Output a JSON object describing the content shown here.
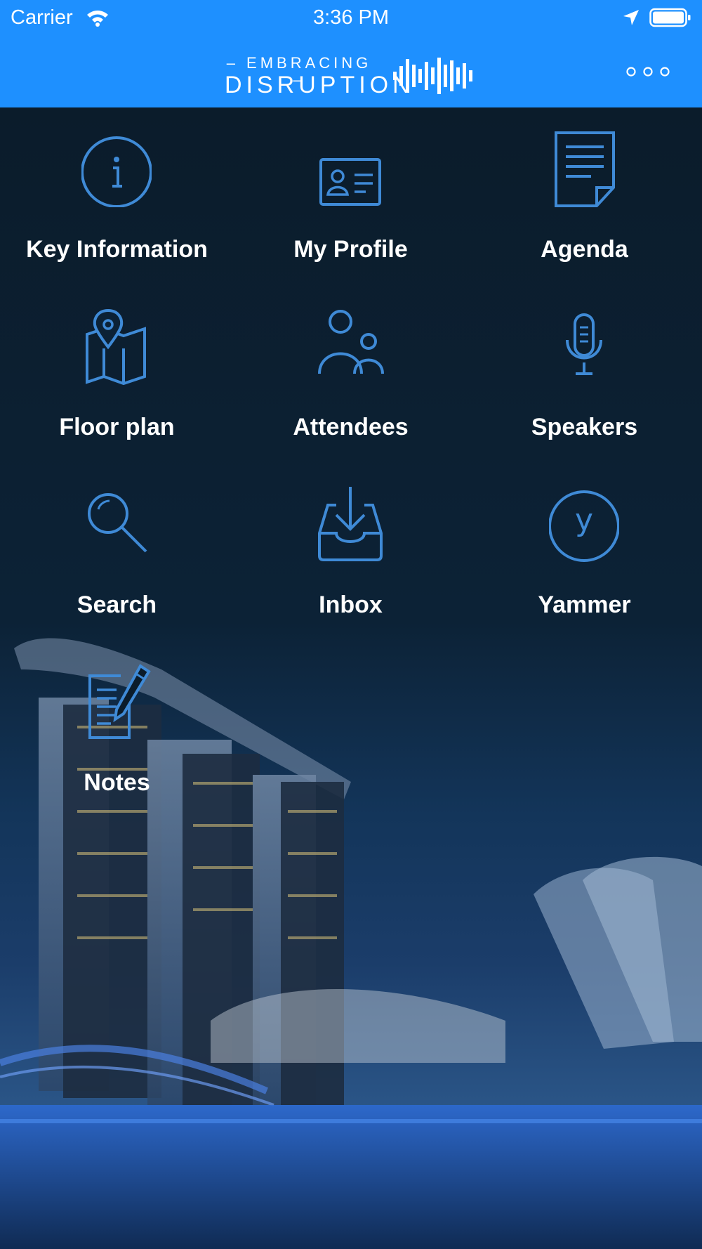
{
  "status_bar": {
    "carrier": "Carrier",
    "time": "3:36 PM"
  },
  "header": {
    "logo_top": "– EMBRACING –",
    "logo_main": "DISRUPTION"
  },
  "menu": [
    {
      "label": "Key Information",
      "icon": "info-icon"
    },
    {
      "label": "My Profile",
      "icon": "profile-card-icon"
    },
    {
      "label": "Agenda",
      "icon": "document-icon"
    },
    {
      "label": "Floor plan",
      "icon": "map-pin-icon"
    },
    {
      "label": "Attendees",
      "icon": "people-icon"
    },
    {
      "label": "Speakers",
      "icon": "microphone-icon"
    },
    {
      "label": "Search",
      "icon": "search-icon"
    },
    {
      "label": "Inbox",
      "icon": "inbox-icon"
    },
    {
      "label": "Yammer",
      "icon": "yammer-icon"
    },
    {
      "label": "Notes",
      "icon": "notes-icon"
    }
  ],
  "colors": {
    "header": "#1e90ff",
    "icon": "#3f8ad6",
    "label": "#ffffff"
  }
}
